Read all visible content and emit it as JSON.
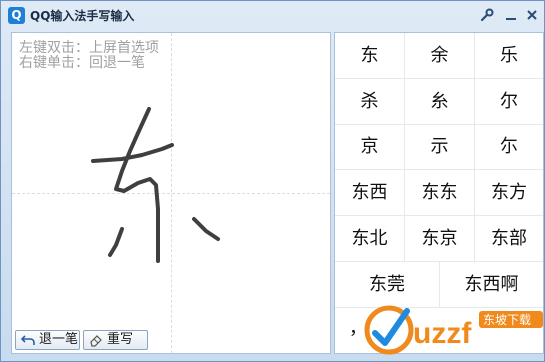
{
  "titlebar": {
    "icon_letter": "Q",
    "title": "QQ输入法手写输入",
    "icons": [
      "settings-icon",
      "minimize-icon",
      "close-icon"
    ]
  },
  "canvas": {
    "hint_line1": "左键双击：上屏首选项",
    "hint_line2": "右键单击：回退一笔",
    "undo_label": "退一笔",
    "rewrite_label": "重写"
  },
  "candidates": {
    "row1": [
      "东",
      "余",
      "乐"
    ],
    "row2": [
      "杀",
      "糸",
      "尔"
    ],
    "row3": [
      "京",
      "示",
      "尓"
    ],
    "row4": [
      "东西",
      "东东",
      "东方"
    ],
    "row5": [
      "东北",
      "东京",
      "东部"
    ],
    "row6": [
      "东莞",
      "东西啊"
    ],
    "punct": "，"
  },
  "watermark": {
    "brand": "uzzf.com",
    "badge": "东坡下载"
  },
  "colors": {
    "accent": "#1f7fd8",
    "stroke": "#3f3f3f",
    "hint": "#a0a0a0",
    "watermark_orange": "#f08a1c"
  }
}
